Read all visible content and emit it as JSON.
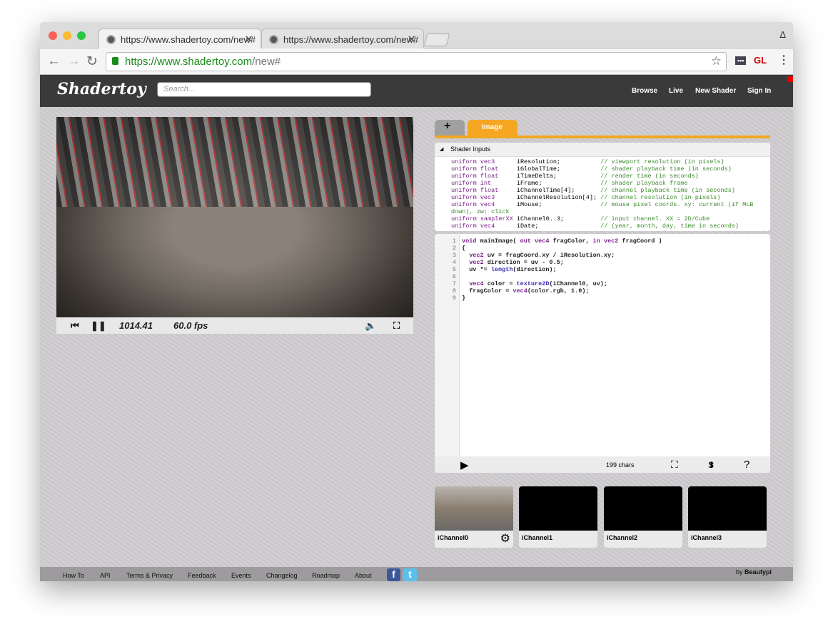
{
  "browser": {
    "tabs": [
      {
        "title": "https://www.shadertoy.com/new#"
      },
      {
        "title": "https://www.shadertoy.com/new#"
      }
    ],
    "url_host": "https://www.shadertoy.com",
    "url_path": "/new#",
    "extensions": [
      "•••",
      "GL"
    ],
    "profile_label": "Δ"
  },
  "site": {
    "logo": "Shadertoy",
    "search_placeholder": "Search...",
    "nav": [
      "Browse",
      "Live",
      "New Shader",
      "Sign In"
    ]
  },
  "player": {
    "time": "1014.41",
    "fps": "60.0 fps"
  },
  "editor": {
    "tab_add": "+",
    "tab_image": "Image",
    "inputs_title": "Shader Inputs",
    "inputs_code": "uniform vec3      iResolution;           // viewport resolution (in pixels)\nuniform float     iGlobalTime;           // shader playback time (in seconds)\nuniform float     iTimeDelta;            // render time (in seconds)\nuniform int       iFrame;                // shader playback frame\nuniform float     iChannelTime[4];       // channel playback time (in seconds)\nuniform vec3      iChannelResolution[4]; // channel resolution (in pixels)\nuniform vec4      iMouse;                // mouse pixel coords. xy: current (if MLB down), zw: click\nuniform samplerXX iChannel0..3;          // input channel. XX = 2D/Cube\nuniform vec4      iDate;                 // (year, month, day, time in seconds)",
    "code": [
      "void mainImage( out vec4 fragColor, in vec2 fragCoord )",
      "{",
      "  vec2 uv = fragCoord.xy / iResolution.xy;",
      "  vec2 direction = uv - 0.5;",
      "  uv *= length(direction);",
      "",
      "  vec4 color = texture2D(iChannel0, uv);",
      "  fragColor = vec4(color.rgb, 1.0);",
      "}"
    ],
    "line_numbers": "1\n2\n3\n4\n5\n6\n7\n8\n9",
    "char_count": "199 chars",
    "font_size_label": "S",
    "help": "?"
  },
  "channels": [
    "iChannel0",
    "iChannel1",
    "iChannel2",
    "iChannel3"
  ],
  "footer": {
    "links": [
      "How To",
      "API",
      "Terms & Privacy",
      "Feedback",
      "Events",
      "Changelog",
      "Roadmap",
      "About"
    ],
    "credit_prefix": "by",
    "credit_name": "Beautypi"
  },
  "colors": {
    "accent": "#f5a623",
    "header": "#3a3a3a"
  }
}
